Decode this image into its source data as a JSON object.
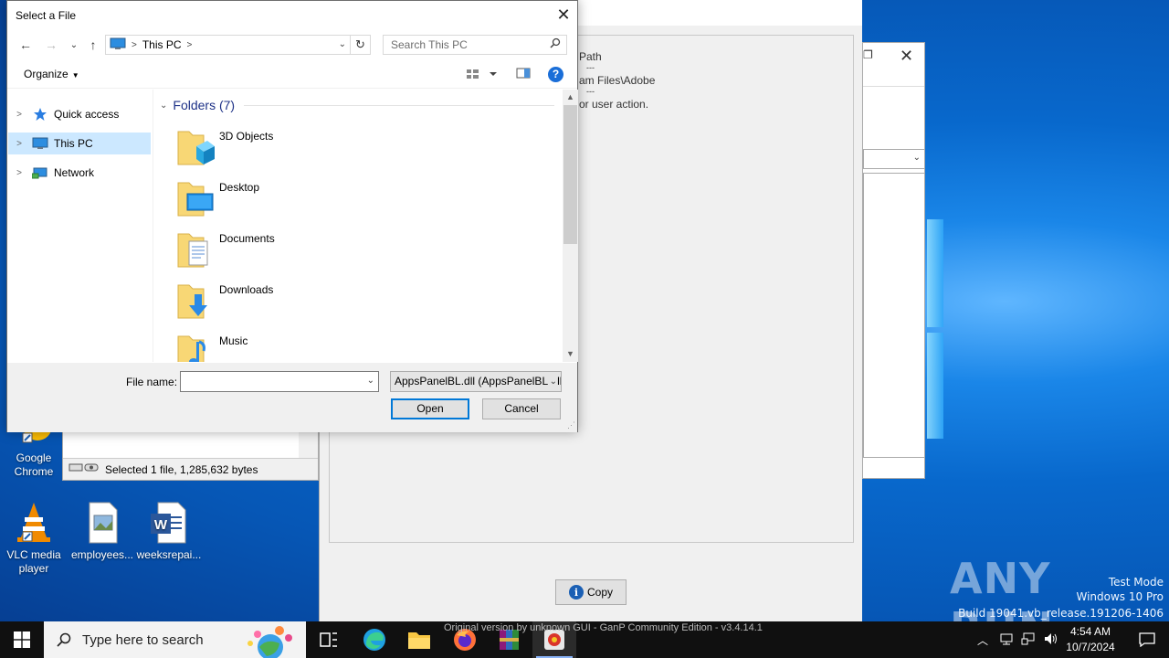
{
  "dialog": {
    "title": "Select a File",
    "address": {
      "location": "This PC"
    },
    "search_placeholder": "Search This PC",
    "organize_label": "Organize",
    "nav": [
      {
        "label": "Quick access",
        "icon": "star-icon",
        "selected": false
      },
      {
        "label": "This PC",
        "icon": "computer-icon",
        "selected": true
      },
      {
        "label": "Network",
        "icon": "network-icon",
        "selected": false
      }
    ],
    "group_header": "Folders (7)",
    "folders": [
      {
        "name": "3D Objects",
        "icon": "3d-objects-folder-icon"
      },
      {
        "name": "Desktop",
        "icon": "desktop-folder-icon"
      },
      {
        "name": "Documents",
        "icon": "documents-folder-icon"
      },
      {
        "name": "Downloads",
        "icon": "downloads-folder-icon"
      },
      {
        "name": "Music",
        "icon": "music-folder-icon"
      }
    ],
    "file_name_label": "File name:",
    "file_name_value": "",
    "file_type_filter": "AppsPanelBL.dll (AppsPanelBL.dll)",
    "open_label": "Open",
    "cancel_label": "Cancel"
  },
  "background_app": {
    "lines": [
      "Path",
      "---",
      "am Files\\Adobe",
      "---",
      "or user action."
    ],
    "copy_label": "Copy",
    "footer": "Original version by unknown GUI - GanP Community Edition - v3.4.14.1"
  },
  "explorer_status": "Selected 1 file, 1,285,632 bytes",
  "desktop_icons": [
    {
      "label": "Google Chrome"
    },
    {
      "label": "VLC media player"
    },
    {
      "label": "employees..."
    },
    {
      "label": "weeksrepai..."
    }
  ],
  "watermark": {
    "brand": "ANY RUN",
    "line1": "Test Mode",
    "line2": "Windows 10 Pro",
    "line3": "Build 19041.vb_release.191206-1406"
  },
  "taskbar": {
    "search_placeholder": "Type here to search",
    "time": "4:54 AM",
    "date": "10/7/2024"
  },
  "colors": {
    "accent": "#0078d7",
    "selection": "#cce8ff",
    "group_header": "#1e3287",
    "taskbar": "#101010"
  }
}
